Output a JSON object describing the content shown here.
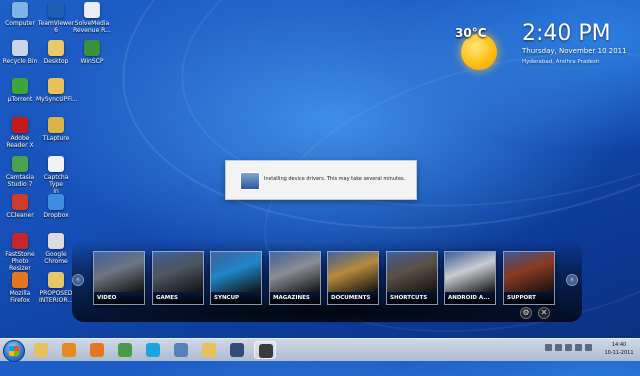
{
  "desktop_icons": [
    {
      "label": "Computer",
      "color": "#7fb2e5"
    },
    {
      "label": "TeamViewer\n6",
      "color": "#1c5fb4"
    },
    {
      "label": "SolveMedia\nRevenue R...",
      "color": "#e9eef5"
    },
    {
      "label": "Recycle Bin",
      "color": "#c9d6e6"
    },
    {
      "label": "Desktop",
      "color": "#e9c96a"
    },
    {
      "label": "WinSCP",
      "color": "#3c8f3c"
    },
    {
      "label": "µTorrent",
      "color": "#3da33d"
    },
    {
      "label": "MySyncUPFi...",
      "color": "#e7c15a"
    },
    {
      "label": "Adobe\nReader X",
      "color": "#c41a1a"
    },
    {
      "label": "TLapture",
      "color": "#d9b24a"
    },
    {
      "label": "Camtasia\nStudio 7",
      "color": "#4aa150"
    },
    {
      "label": "Captcha Type\nIn",
      "color": "#eef2f7"
    },
    {
      "label": "CCleaner",
      "color": "#d03a2a"
    },
    {
      "label": "Dropbox",
      "color": "#3c8ee0"
    },
    {
      "label": "FastStone\nPhoto Resizer",
      "color": "#c8262a"
    },
    {
      "label": "Google\nChrome",
      "color": "#dcdcdc"
    },
    {
      "label": "Mozilla\nFirefox",
      "color": "#e2771f"
    },
    {
      "label": "PROPOSED\nINTERIOR...",
      "color": "#e6c769"
    }
  ],
  "weather": {
    "temperature": "30°C"
  },
  "clock": {
    "time": "2:40",
    "ampm": "PM",
    "date": "Thursday, November 10 2011",
    "location": "Hyderabad, Andhra Pradesh"
  },
  "dialog": {
    "message": "Installing device drivers. This may take several minutes."
  },
  "launcher": {
    "prev_arrow": "‹",
    "next_arrow": "›",
    "settings_glyph": "⚙",
    "close_glyph": "✕",
    "tiles": [
      {
        "label": "VIDEO",
        "color": "#6d7682"
      },
      {
        "label": "GAMES",
        "color": "#4e5660"
      },
      {
        "label": "SYNCUP",
        "color": "#1f87c9"
      },
      {
        "label": "MAGAZINES",
        "color": "#8a8f96"
      },
      {
        "label": "DOCUMENTS",
        "color": "#b78a3c"
      },
      {
        "label": "SHORTCUTS",
        "color": "#5b5148"
      },
      {
        "label": "ANDROID A...",
        "color": "#c9cdd3"
      },
      {
        "label": "SUPPORT",
        "color": "#8a3a22"
      }
    ]
  },
  "taskbar": {
    "apps": [
      {
        "name": "explorer-icon",
        "color": "#e7c15a"
      },
      {
        "name": "media-player-icon",
        "color": "#e48a1c"
      },
      {
        "name": "firefox-icon",
        "color": "#e2771f"
      },
      {
        "name": "chrome-icon",
        "color": "#4a9a4a"
      },
      {
        "name": "skype-icon",
        "color": "#1aa3e0"
      },
      {
        "name": "network-icon",
        "color": "#5a7fb8"
      },
      {
        "name": "folder-icon",
        "color": "#e7c15a"
      },
      {
        "name": "mail-icon",
        "color": "#324b7a"
      },
      {
        "name": "tool-icon",
        "color": "#3b3b3b"
      }
    ],
    "clock_time": "14:40",
    "clock_date": "10-11-2011"
  }
}
